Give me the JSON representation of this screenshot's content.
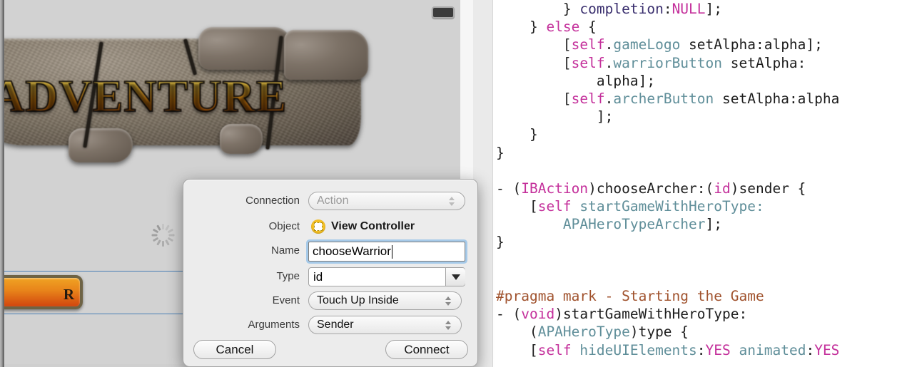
{
  "canvas": {
    "game_logo_text": "ADVENTURE",
    "warrior_button_label": "R",
    "top_right_button_name": "menu-button",
    "spinner_name": "loading-spinner"
  },
  "dialog": {
    "title": "Connection inspector popover",
    "rows": [
      {
        "label": "Connection",
        "value": "Action",
        "control": "popup-disabled"
      },
      {
        "label": "Object",
        "value": "View Controller",
        "control": "object-token"
      },
      {
        "label": "Name",
        "value": "chooseWarrior",
        "control": "text-field",
        "placeholder": "Name"
      },
      {
        "label": "Type",
        "value": "id",
        "control": "combo-box"
      },
      {
        "label": "Event",
        "value": "Touch Up Inside",
        "control": "popup"
      },
      {
        "label": "Arguments",
        "value": "Sender",
        "control": "popup"
      }
    ],
    "cancel_label": "Cancel",
    "connect_label": "Connect",
    "focus_ring_color": "#6daee8",
    "object_icon_color": "#f5c024"
  },
  "editor": {
    "lines": [
      [
        {
          "t": "        } ",
          "c": "plain"
        },
        {
          "t": "completion",
          "c": "sel"
        },
        {
          "t": ":",
          "c": "plain"
        },
        {
          "t": "NULL",
          "c": "kw"
        },
        {
          "t": "];",
          "c": "plain"
        }
      ],
      [
        {
          "t": "    } ",
          "c": "plain"
        },
        {
          "t": "else",
          "c": "kw"
        },
        {
          "t": " {",
          "c": "plain"
        }
      ],
      [
        {
          "t": "        [",
          "c": "plain"
        },
        {
          "t": "self",
          "c": "kw"
        },
        {
          "t": ".",
          "c": "plain"
        },
        {
          "t": "gameLogo",
          "c": "prop"
        },
        {
          "t": " setAlpha:alpha];",
          "c": "plain"
        }
      ],
      [
        {
          "t": "        [",
          "c": "plain"
        },
        {
          "t": "self",
          "c": "kw"
        },
        {
          "t": ".",
          "c": "plain"
        },
        {
          "t": "warriorButton",
          "c": "prop"
        },
        {
          "t": " setAlpha:",
          "c": "plain"
        }
      ],
      [
        {
          "t": "            alpha];",
          "c": "plain"
        }
      ],
      [
        {
          "t": "        [",
          "c": "plain"
        },
        {
          "t": "self",
          "c": "kw"
        },
        {
          "t": ".",
          "c": "plain"
        },
        {
          "t": "archerButton",
          "c": "prop"
        },
        {
          "t": " setAlpha:alpha",
          "c": "plain"
        }
      ],
      [
        {
          "t": "            ];",
          "c": "plain"
        }
      ],
      [
        {
          "t": "    }",
          "c": "plain"
        }
      ],
      [
        {
          "t": "}",
          "c": "plain"
        }
      ],
      [
        {
          "t": "",
          "c": "plain"
        }
      ],
      [
        {
          "t": "- (",
          "c": "plain"
        },
        {
          "t": "IBAction",
          "c": "kw"
        },
        {
          "t": ")chooseArcher:(",
          "c": "plain"
        },
        {
          "t": "id",
          "c": "kw"
        },
        {
          "t": ")sender {",
          "c": "plain"
        }
      ],
      [
        {
          "t": "    [",
          "c": "plain"
        },
        {
          "t": "self",
          "c": "kw"
        },
        {
          "t": " ",
          "c": "plain"
        },
        {
          "t": "startGameWithHeroType:",
          "c": "prop"
        }
      ],
      [
        {
          "t": "        ",
          "c": "plain"
        },
        {
          "t": "APAHeroTypeArcher",
          "c": "prop"
        },
        {
          "t": "];",
          "c": "plain"
        }
      ],
      [
        {
          "t": "}",
          "c": "plain"
        }
      ],
      [
        {
          "t": "",
          "c": "plain"
        }
      ],
      [
        {
          "t": "",
          "c": "plain"
        }
      ],
      [
        {
          "t": "#pragma mark - Starting the Game",
          "c": "pragma"
        }
      ],
      [
        {
          "t": "- (",
          "c": "plain"
        },
        {
          "t": "void",
          "c": "kw"
        },
        {
          "t": ")startGameWithHeroType:",
          "c": "plain"
        }
      ],
      [
        {
          "t": "    (",
          "c": "plain"
        },
        {
          "t": "APAHeroType",
          "c": "prop"
        },
        {
          "t": ")type {",
          "c": "plain"
        }
      ],
      [
        {
          "t": "    [",
          "c": "plain"
        },
        {
          "t": "self",
          "c": "kw"
        },
        {
          "t": " ",
          "c": "plain"
        },
        {
          "t": "hideUIElements",
          "c": "prop"
        },
        {
          "t": ":",
          "c": "plain"
        },
        {
          "t": "YES",
          "c": "kw"
        },
        {
          "t": " ",
          "c": "plain"
        },
        {
          "t": "animated",
          "c": "prop"
        },
        {
          "t": ":",
          "c": "plain"
        },
        {
          "t": "YES",
          "c": "kw"
        }
      ]
    ]
  }
}
